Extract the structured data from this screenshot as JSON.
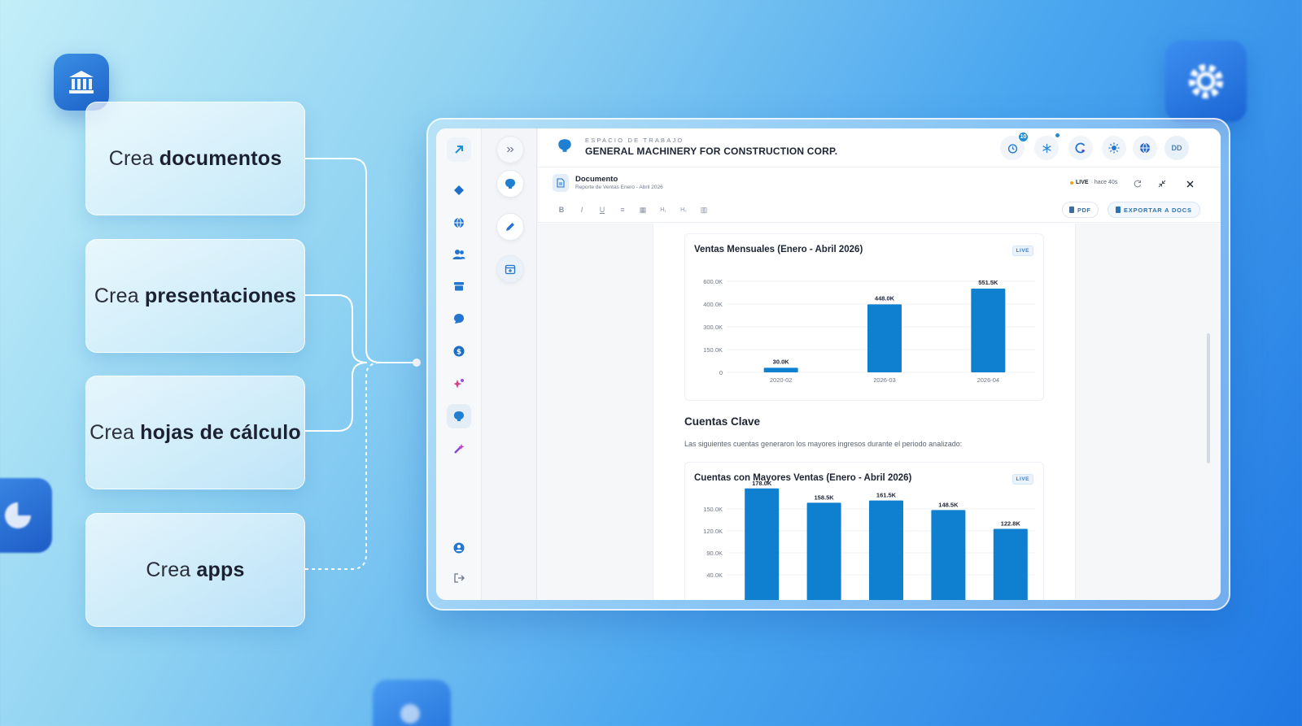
{
  "features": [
    {
      "prefix": "Crea",
      "bold": "documentos"
    },
    {
      "prefix": "Crea",
      "bold": "presentaciones"
    },
    {
      "prefix": "Crea",
      "bold": "hojas de cálculo"
    },
    {
      "prefix": "Crea",
      "bold": "apps"
    }
  ],
  "workspace": {
    "label": "ESPACIO DE TRABAJO",
    "name": "GENERAL MACHINERY FOR CONSTRUCTION CORP."
  },
  "header": {
    "notification_count": "10",
    "avatar_initials": "DD"
  },
  "document": {
    "title": "Documento",
    "subtitle": "Reporte de Ventas Enero - Abril 2026",
    "live_label": "LIVE",
    "updated": "· hace 40s"
  },
  "toolbar": {
    "format_buttons": [
      "B",
      "I",
      "U",
      "≡",
      "▦",
      "H₁",
      "H₂",
      "▥"
    ],
    "pdf_label": "PDF",
    "export_label": "EXPORTAR A DOCS"
  },
  "content": {
    "section_title": "Cuentas Clave",
    "section_text": "Las siguientes cuentas generaron los mayores ingresos durante el periodo analizado:"
  },
  "chart_data": [
    {
      "type": "bar",
      "title": "Ventas Mensuales (Enero - Abril 2026)",
      "badge": "LIVE",
      "categories": [
        "2020-02",
        "2026-03",
        "2026-04"
      ],
      "values": [
        30.0,
        448.0,
        551.5
      ],
      "value_labels": [
        "30.0K",
        "448.0K",
        "551.5K"
      ],
      "yticks": [
        "600.0K",
        "400.0K",
        "300.0K",
        "150.0K",
        "0"
      ],
      "ylim": [
        0,
        600
      ],
      "color": "#0f7fcf"
    },
    {
      "type": "bar",
      "title": "Cuentas con Mayores Ventas (Enero - Abril 2026)",
      "badge": "LIVE",
      "categories": [
        "",
        "",
        "",
        "",
        ""
      ],
      "values": [
        178.0,
        158.5,
        161.5,
        148.5,
        122.8
      ],
      "value_labels": [
        "178.0K",
        "158.5K",
        "161.5K",
        "148.5K",
        "122.8K"
      ],
      "yticks": [
        "150.0K",
        "120.0K",
        "90.0K",
        "40.0K"
      ],
      "color": "#0f7fcf"
    }
  ],
  "colors": {
    "accent": "#0f7fcf",
    "live_dot": "#f4a11b"
  }
}
